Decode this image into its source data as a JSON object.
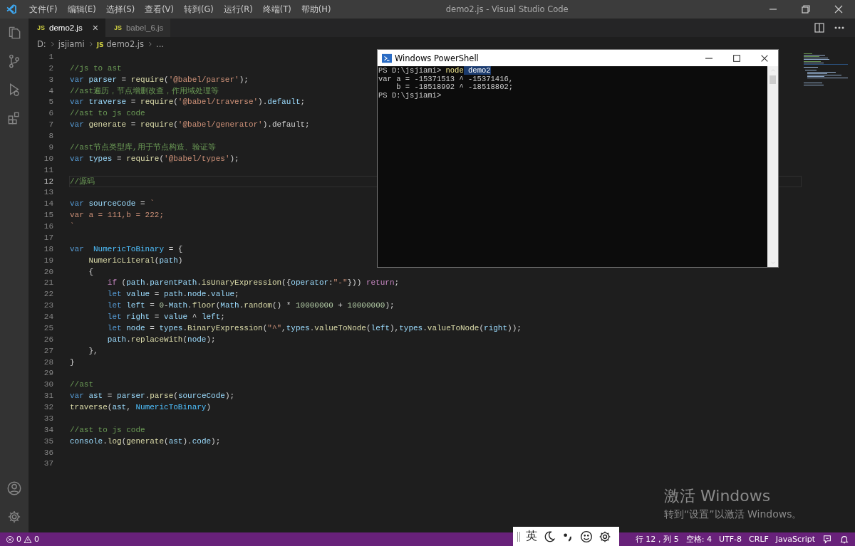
{
  "window": {
    "title": "demo2.js - Visual Studio Code"
  },
  "menu": [
    "文件(F)",
    "编辑(E)",
    "选择(S)",
    "查看(V)",
    "转到(G)",
    "运行(R)",
    "终端(T)",
    "帮助(H)"
  ],
  "tabs": [
    {
      "badge": "JS",
      "label": "demo2.js",
      "selected": true,
      "close": "×"
    },
    {
      "badge": "JS",
      "label": "babel_6.js",
      "selected": false
    }
  ],
  "breadcrumb": {
    "parts": [
      "D:",
      "jsjiami"
    ],
    "file_badge": "JS",
    "file": "demo2.js",
    "more": "..."
  },
  "code_lines": [
    {
      "number": "1",
      "current": false
    },
    {
      "number": "2",
      "current": false,
      "tokens": [
        {
          "kind": "comment",
          "text": "//js to ast"
        }
      ]
    },
    {
      "number": "3",
      "current": false,
      "tokens": [
        {
          "kind": "keyword",
          "text": "var "
        },
        {
          "kind": "variable",
          "text": "parser"
        },
        {
          "kind": "plain",
          "text": " = "
        },
        {
          "kind": "function",
          "text": "require"
        },
        {
          "kind": "plain",
          "text": "("
        },
        {
          "kind": "string",
          "text": "'@babel/parser'"
        },
        {
          "kind": "plain",
          "text": ");"
        }
      ]
    },
    {
      "number": "4",
      "current": false,
      "tokens": [
        {
          "kind": "comment",
          "text": "//ast遍历，节点增删改查，作用域处理等"
        }
      ]
    },
    {
      "number": "5",
      "current": false,
      "tokens": [
        {
          "kind": "keyword",
          "text": "var "
        },
        {
          "kind": "variable",
          "text": "traverse"
        },
        {
          "kind": "plain",
          "text": " = "
        },
        {
          "kind": "function",
          "text": "require"
        },
        {
          "kind": "plain",
          "text": "("
        },
        {
          "kind": "string",
          "text": "'@babel/traverse'"
        },
        {
          "kind": "plain",
          "text": ")."
        },
        {
          "kind": "variable",
          "text": "default"
        },
        {
          "kind": "plain",
          "text": ";"
        }
      ]
    },
    {
      "number": "6",
      "current": false,
      "tokens": [
        {
          "kind": "comment",
          "text": "//ast to js code"
        }
      ]
    },
    {
      "number": "7",
      "current": false,
      "tokens": [
        {
          "kind": "keyword",
          "text": "var "
        },
        {
          "kind": "function",
          "text": "generate"
        },
        {
          "kind": "plain",
          "text": " = "
        },
        {
          "kind": "function",
          "text": "require"
        },
        {
          "kind": "plain",
          "text": "("
        },
        {
          "kind": "string",
          "text": "'@babel/generator'"
        },
        {
          "kind": "plain",
          "text": ").default;"
        }
      ]
    },
    {
      "number": "8",
      "current": false
    },
    {
      "number": "9",
      "current": false,
      "tokens": [
        {
          "kind": "comment",
          "text": "//ast节点类型库,用于节点构造、验证等"
        }
      ]
    },
    {
      "number": "10",
      "current": false,
      "tokens": [
        {
          "kind": "keyword",
          "text": "var "
        },
        {
          "kind": "variable",
          "text": "types"
        },
        {
          "kind": "plain",
          "text": " = "
        },
        {
          "kind": "function",
          "text": "require"
        },
        {
          "kind": "plain",
          "text": "("
        },
        {
          "kind": "string",
          "text": "'@babel/types'"
        },
        {
          "kind": "plain",
          "text": ");"
        }
      ]
    },
    {
      "number": "11",
      "current": false
    },
    {
      "number": "12",
      "current": true,
      "tokens": [
        {
          "kind": "comment",
          "text": "//源码"
        }
      ]
    },
    {
      "number": "13",
      "current": false
    },
    {
      "number": "14",
      "current": false,
      "tokens": [
        {
          "kind": "keyword",
          "text": "var "
        },
        {
          "kind": "variable",
          "text": "sourceCode"
        },
        {
          "kind": "plain",
          "text": " = "
        },
        {
          "kind": "string",
          "text": "`"
        }
      ]
    },
    {
      "number": "15",
      "current": false,
      "tokens": [
        {
          "kind": "string",
          "text": "var a = 111,b = 222;"
        }
      ]
    },
    {
      "number": "16",
      "current": false,
      "tokens": [
        {
          "kind": "string",
          "text": "`"
        }
      ]
    },
    {
      "number": "17",
      "current": false
    },
    {
      "number": "18",
      "current": false,
      "tokens": [
        {
          "kind": "keyword",
          "text": "var "
        },
        {
          "kind": "constant",
          "text": " NumericToBinary"
        },
        {
          "kind": "plain",
          "text": " = {"
        }
      ]
    },
    {
      "number": "19",
      "current": false,
      "tokens": [
        {
          "kind": "function",
          "text": "    NumericLiteral"
        },
        {
          "kind": "plain",
          "text": "("
        },
        {
          "kind": "variable",
          "text": "path"
        },
        {
          "kind": "plain",
          "text": ")"
        }
      ]
    },
    {
      "number": "20",
      "current": false,
      "tokens": [
        {
          "kind": "plain",
          "text": "    {"
        }
      ]
    },
    {
      "number": "21",
      "current": false,
      "tokens": [
        {
          "kind": "control",
          "text": "        if"
        },
        {
          "kind": "plain",
          "text": " ("
        },
        {
          "kind": "variable",
          "text": "path"
        },
        {
          "kind": "plain",
          "text": "."
        },
        {
          "kind": "variable",
          "text": "parentPath"
        },
        {
          "kind": "plain",
          "text": "."
        },
        {
          "kind": "function",
          "text": "isUnaryExpression"
        },
        {
          "kind": "plain",
          "text": "({"
        },
        {
          "kind": "variable",
          "text": "operator"
        },
        {
          "kind": "plain",
          "text": ":"
        },
        {
          "kind": "string",
          "text": "\"-\""
        },
        {
          "kind": "plain",
          "text": "})) "
        },
        {
          "kind": "control",
          "text": "return"
        },
        {
          "kind": "plain",
          "text": ";"
        }
      ]
    },
    {
      "number": "22",
      "current": false,
      "tokens": [
        {
          "kind": "keyword",
          "text": "        let "
        },
        {
          "kind": "variable",
          "text": "value"
        },
        {
          "kind": "plain",
          "text": " = "
        },
        {
          "kind": "variable",
          "text": "path"
        },
        {
          "kind": "plain",
          "text": "."
        },
        {
          "kind": "variable",
          "text": "node"
        },
        {
          "kind": "plain",
          "text": "."
        },
        {
          "kind": "variable",
          "text": "value"
        },
        {
          "kind": "plain",
          "text": ";"
        }
      ]
    },
    {
      "number": "23",
      "current": false,
      "tokens": [
        {
          "kind": "keyword",
          "text": "        let "
        },
        {
          "kind": "variable",
          "text": "left"
        },
        {
          "kind": "plain",
          "text": " = "
        },
        {
          "kind": "number",
          "text": "0"
        },
        {
          "kind": "plain",
          "text": "-"
        },
        {
          "kind": "variable",
          "text": "Math"
        },
        {
          "kind": "plain",
          "text": "."
        },
        {
          "kind": "function",
          "text": "floor"
        },
        {
          "kind": "plain",
          "text": "("
        },
        {
          "kind": "variable",
          "text": "Math"
        },
        {
          "kind": "plain",
          "text": "."
        },
        {
          "kind": "function",
          "text": "random"
        },
        {
          "kind": "plain",
          "text": "() * "
        },
        {
          "kind": "number",
          "text": "10000000"
        },
        {
          "kind": "plain",
          "text": " + "
        },
        {
          "kind": "number",
          "text": "10000000"
        },
        {
          "kind": "plain",
          "text": ");"
        }
      ]
    },
    {
      "number": "24",
      "current": false,
      "tokens": [
        {
          "kind": "keyword",
          "text": "        let "
        },
        {
          "kind": "variable",
          "text": "right"
        },
        {
          "kind": "plain",
          "text": " = "
        },
        {
          "kind": "variable",
          "text": "value"
        },
        {
          "kind": "plain",
          "text": " ^ "
        },
        {
          "kind": "variable",
          "text": "left"
        },
        {
          "kind": "plain",
          "text": ";"
        }
      ]
    },
    {
      "number": "25",
      "current": false,
      "tokens": [
        {
          "kind": "keyword",
          "text": "        let "
        },
        {
          "kind": "variable",
          "text": "node"
        },
        {
          "kind": "plain",
          "text": " = "
        },
        {
          "kind": "variable",
          "text": "types"
        },
        {
          "kind": "plain",
          "text": "."
        },
        {
          "kind": "function",
          "text": "BinaryExpression"
        },
        {
          "kind": "plain",
          "text": "("
        },
        {
          "kind": "string",
          "text": "\"^\""
        },
        {
          "kind": "plain",
          "text": ","
        },
        {
          "kind": "variable",
          "text": "types"
        },
        {
          "kind": "plain",
          "text": "."
        },
        {
          "kind": "function",
          "text": "valueToNode"
        },
        {
          "kind": "plain",
          "text": "("
        },
        {
          "kind": "variable",
          "text": "left"
        },
        {
          "kind": "plain",
          "text": "),"
        },
        {
          "kind": "variable",
          "text": "types"
        },
        {
          "kind": "plain",
          "text": "."
        },
        {
          "kind": "function",
          "text": "valueToNode"
        },
        {
          "kind": "plain",
          "text": "("
        },
        {
          "kind": "variable",
          "text": "right"
        },
        {
          "kind": "plain",
          "text": "));"
        }
      ]
    },
    {
      "number": "26",
      "current": false,
      "tokens": [
        {
          "kind": "variable",
          "text": "        path"
        },
        {
          "kind": "plain",
          "text": "."
        },
        {
          "kind": "function",
          "text": "replaceWith"
        },
        {
          "kind": "plain",
          "text": "("
        },
        {
          "kind": "variable",
          "text": "node"
        },
        {
          "kind": "plain",
          "text": ");"
        }
      ]
    },
    {
      "number": "27",
      "current": false,
      "tokens": [
        {
          "kind": "plain",
          "text": "    },"
        }
      ]
    },
    {
      "number": "28",
      "current": false,
      "tokens": [
        {
          "kind": "plain",
          "text": "}"
        }
      ]
    },
    {
      "number": "29",
      "current": false
    },
    {
      "number": "30",
      "current": false,
      "tokens": [
        {
          "kind": "comment",
          "text": "//ast"
        }
      ]
    },
    {
      "number": "31",
      "current": false,
      "tokens": [
        {
          "kind": "keyword",
          "text": "var "
        },
        {
          "kind": "variable",
          "text": "ast"
        },
        {
          "kind": "plain",
          "text": " = "
        },
        {
          "kind": "variable",
          "text": "parser"
        },
        {
          "kind": "plain",
          "text": "."
        },
        {
          "kind": "function",
          "text": "parse"
        },
        {
          "kind": "plain",
          "text": "("
        },
        {
          "kind": "variable",
          "text": "sourceCode"
        },
        {
          "kind": "plain",
          "text": ");"
        }
      ]
    },
    {
      "number": "32",
      "current": false,
      "tokens": [
        {
          "kind": "function",
          "text": "traverse"
        },
        {
          "kind": "plain",
          "text": "("
        },
        {
          "kind": "variable",
          "text": "ast"
        },
        {
          "kind": "plain",
          "text": ", "
        },
        {
          "kind": "constant",
          "text": "NumericToBinary"
        },
        {
          "kind": "plain",
          "text": ")"
        }
      ]
    },
    {
      "number": "33",
      "current": false
    },
    {
      "number": "34",
      "current": false,
      "tokens": [
        {
          "kind": "comment",
          "text": "//ast to js code"
        }
      ]
    },
    {
      "number": "35",
      "current": false,
      "tokens": [
        {
          "kind": "variable",
          "text": "console"
        },
        {
          "kind": "plain",
          "text": "."
        },
        {
          "kind": "function",
          "text": "log"
        },
        {
          "kind": "plain",
          "text": "("
        },
        {
          "kind": "function",
          "text": "generate"
        },
        {
          "kind": "plain",
          "text": "("
        },
        {
          "kind": "variable",
          "text": "ast"
        },
        {
          "kind": "plain",
          "text": ")."
        },
        {
          "kind": "variable",
          "text": "code"
        },
        {
          "kind": "plain",
          "text": ");"
        }
      ]
    },
    {
      "number": "36",
      "current": false
    },
    {
      "number": "37",
      "current": false
    }
  ],
  "powershell": {
    "title": "Windows PowerShell",
    "lines": [
      [
        {
          "kind": "plain",
          "text": "PS D:\\jsjiami> "
        },
        {
          "kind": "command",
          "text": "node"
        },
        {
          "kind": "selection",
          "text": " demo2"
        }
      ],
      [
        {
          "kind": "plain",
          "text": "var a = -15371513 ^ -15371416,"
        }
      ],
      [
        {
          "kind": "plain",
          "text": "    b = -18518992 ^ -18518802;"
        }
      ],
      [
        {
          "kind": "plain",
          "text": "PS D:\\jsjiami>"
        }
      ]
    ]
  },
  "activation": {
    "title": "激活 Windows",
    "hint": "转到“设置”以激活 Windows。"
  },
  "ime_bar": {
    "mode": "英"
  },
  "status_bar": {
    "errors": "0",
    "warnings": "0",
    "items": [
      "行 12，列 5",
      "空格: 4",
      "UTF-8",
      "CRLF",
      "JavaScript"
    ]
  }
}
